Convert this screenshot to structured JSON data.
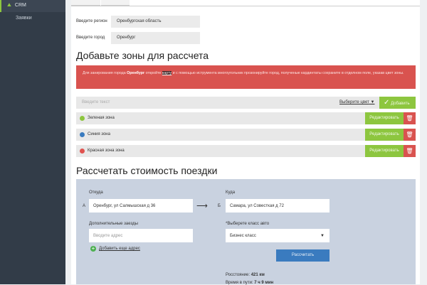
{
  "sidebar": {
    "items": [
      {
        "label": "CRM"
      },
      {
        "label": "Заявки"
      }
    ]
  },
  "form": {
    "region_label": "Введите регион",
    "region_value": "Оренбургская область",
    "city_label": "Введите город",
    "city_value": "Оренбург"
  },
  "zones": {
    "title": "Добавьте зоны для рассчета",
    "alert": {
      "p1": "Для занирования города ",
      "city": "Оренбург",
      "p2": " откройте ",
      "link": "карту",
      "p3": " и с помощью иструмента многоугольник прозонируйте город, полученые кардинтаты сохраните в отделном поле, указав цвет зоны."
    },
    "input_placeholder": "Введите текст",
    "color_select": "Выберите цвет",
    "add_label": "Добавить",
    "items": [
      {
        "name": "Зеленая зона",
        "color": "#8dc63f"
      },
      {
        "name": "Синия зона",
        "color": "#3a7bbf"
      },
      {
        "name": "Красная зона зона",
        "color": "#e0534f"
      }
    ],
    "edit_label": "Редактировать"
  },
  "trip": {
    "title": "Рассчетать стоимость поездки",
    "from_label": "Откуда",
    "from_marker": "А",
    "from_value": "Оренбург, ул Салмышская д 36",
    "to_label": "Куда",
    "to_marker": "Б",
    "to_value": "Самара, ул Совесткая д 72",
    "extra_label": "Дополнительные заезды",
    "extra_placeholder": "Вводите адрес",
    "add_address": "Добавить еще адрес",
    "class_label": "*Выберете класс авто",
    "class_value": "Бизнес класс",
    "calc_label": "Рассчитать",
    "distance_label": "Росстояние: ",
    "distance": "421 км",
    "time_label": "Время в пути: ",
    "time": "7 ч 9 мин"
  }
}
